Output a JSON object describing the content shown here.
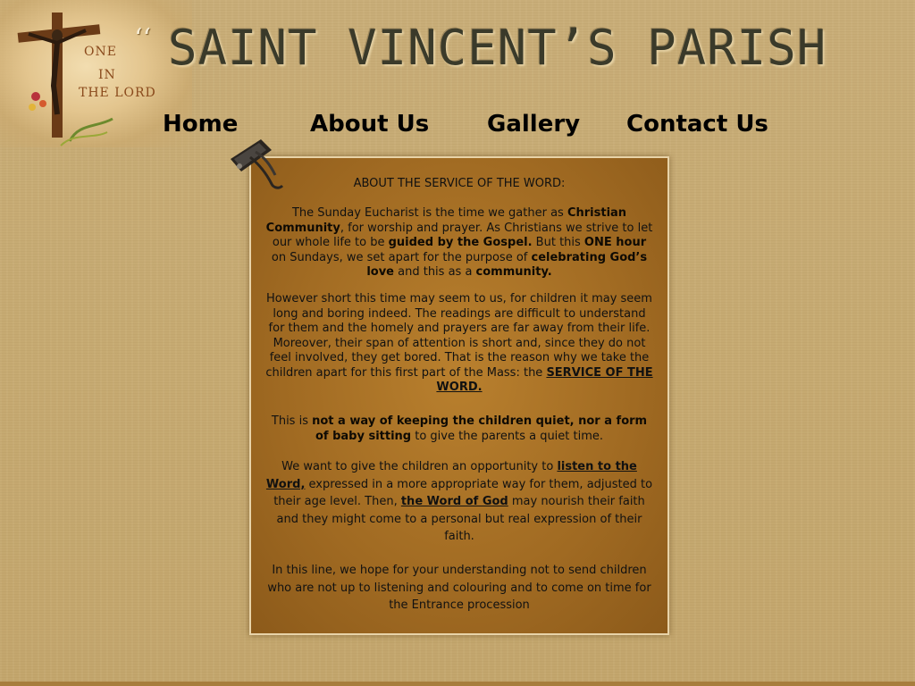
{
  "logo": {
    "line1": "ONE",
    "line2": "IN",
    "line3": "THE LORD"
  },
  "site_title": "SAINT VINCENT’S PARISH",
  "nav": {
    "home": "Home",
    "about": "About Us",
    "gallery": "Gallery",
    "contact": "Contact Us"
  },
  "content": {
    "heading": "ABOUT THE SERVICE OF THE WORD:",
    "p1": {
      "a": "The Sunday Eucharist is the time we gather as ",
      "b": "Christian Community",
      "c": ", for worship and prayer. As Christians we strive to let our whole life to be ",
      "d": "guided by the Gospel.",
      "e": " But this ",
      "f": "ONE hour",
      "g": " on Sundays, we set apart for the purpose of ",
      "h": "celebrating God’s love",
      "i": " and this as a ",
      "j": "community."
    },
    "p2": {
      "a": "However short this time may seem to us, for children it may seem long and boring indeed. The readings are difficult to understand for them and the homely and prayers are far away from their life. Moreover, their span of attention is short and, since they do not feel involved, they get bored. That is the reason why we take the children apart for this first part of the Mass: the ",
      "link": "SERVICE OF THE WORD."
    },
    "p3": {
      "a": "This is ",
      "b": "not a way of keeping the children quiet, nor a form of baby sitting",
      "c": " to give the parents a quiet time."
    },
    "p4": {
      "a": "We want to give the children an opportunity to ",
      "link1": "listen to the Word,",
      "b": " expressed in a more appropriate way for them, adjusted to their age level. Then, ",
      "link2": "the Word of God",
      "c": " may nourish their faith and they might come to a personal but real expression of their faith."
    },
    "p5": "In this line, we hope for your understanding not to send children who are not up to listening and colouring and to come on time for the Entrance procession"
  }
}
